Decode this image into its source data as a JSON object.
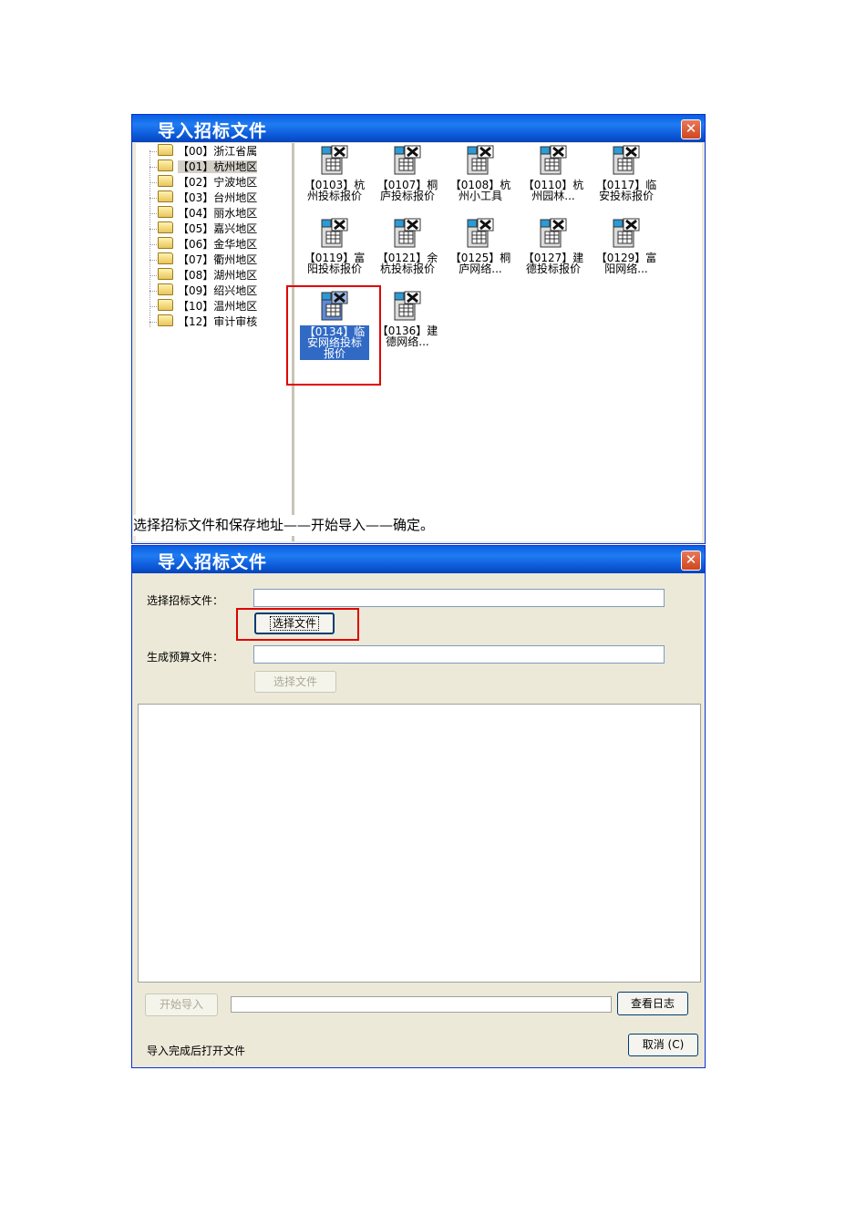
{
  "window1": {
    "title": "导入招标文件",
    "close": "✕",
    "tree": [
      {
        "label": "【00】浙江省属"
      },
      {
        "label": "【01】杭州地区"
      },
      {
        "label": "【02】宁波地区"
      },
      {
        "label": "【03】台州地区"
      },
      {
        "label": "【04】丽水地区"
      },
      {
        "label": "【05】嘉兴地区"
      },
      {
        "label": "【06】金华地区"
      },
      {
        "label": "【07】衢州地区"
      },
      {
        "label": "【08】湖州地区"
      },
      {
        "label": "【09】绍兴地区"
      },
      {
        "label": "【10】温州地区"
      },
      {
        "label": "【12】审计审核"
      }
    ],
    "selected_tree_index": 1,
    "files": [
      {
        "line1": "【0103】杭",
        "line2": "州投标报价"
      },
      {
        "line1": "【0107】桐",
        "line2": "庐投标报价"
      },
      {
        "line1": "【0108】杭",
        "line2": "州小工具"
      },
      {
        "line1": "【0110】杭",
        "line2": "州园林..."
      },
      {
        "line1": "【0117】临",
        "line2": "安投标报价"
      },
      {
        "line1": "【0119】富",
        "line2": "阳投标报价"
      },
      {
        "line1": "【0121】余",
        "line2": "杭投标报价"
      },
      {
        "line1": "【0125】桐",
        "line2": "庐网络..."
      },
      {
        "line1": "【0127】建",
        "line2": "德投标报价"
      },
      {
        "line1": "【0129】富",
        "line2": "阳网络..."
      },
      {
        "line1": "【0134】临",
        "line2": "安网络投标",
        "line3": "报价"
      },
      {
        "line1": "【0136】建",
        "line2": "德网络..."
      }
    ],
    "selected_file_index": 10
  },
  "caption": "选择招标文件和保存地址——开始导入——确定。",
  "window2": {
    "title": "导入招标文件",
    "close": "✕",
    "select_bid_label": "选择招标文件：",
    "select_bid_value": "",
    "select_file_button": "选择文件",
    "gen_budget_label": "生成预算文件：",
    "gen_budget_value": "",
    "select_file_button2": "选择文件",
    "start_import": "开始导入",
    "view_log": "查看日志",
    "open_after": "导入完成后打开文件",
    "cancel": "取消 (C)",
    "progress": 0
  },
  "colors": {
    "highlight": "#e00000",
    "selection": "#316ac5",
    "titlebar": "#0a5fe0"
  },
  "icons": {
    "file": "excel-bid-file-icon",
    "folder": "folder-icon"
  }
}
